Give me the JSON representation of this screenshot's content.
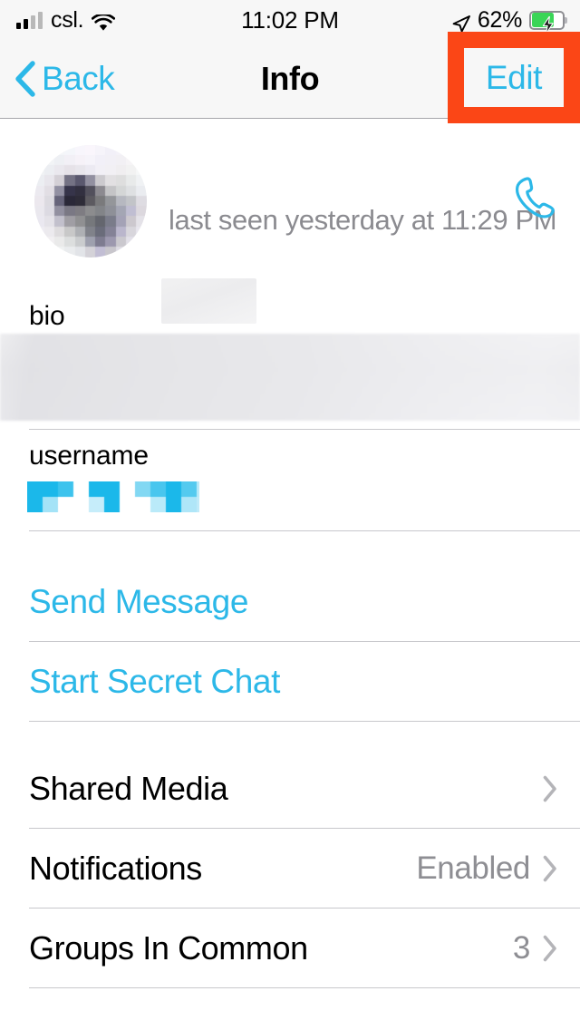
{
  "status_bar": {
    "carrier": "csl.",
    "time": "11:02 PM",
    "battery_percent": "62%",
    "signal_bars_filled": 2,
    "signal_bars_total": 4,
    "wifi_icon": "wifi-icon",
    "location_icon": "location-arrow-icon",
    "battery_icon": "battery-charging-icon",
    "battery_level": 62,
    "charging": true
  },
  "nav_bar": {
    "back_label": "Back",
    "back_icon": "chevron-left-icon",
    "title": "Info",
    "edit_label": "Edit",
    "highlight_color": "#fb4616"
  },
  "profile": {
    "avatar_icon": "avatar-image-pixelated",
    "name": "",
    "name_redacted": true,
    "status": "last seen yesterday at 11:29 PM",
    "call_icon": "phone-call-icon"
  },
  "fields": [
    {
      "label": "bio",
      "value": "",
      "redacted": true,
      "redaction_style": "blur"
    },
    {
      "label": "username",
      "value": "",
      "redacted": true,
      "redaction_style": "pixelate",
      "pixel_color": "#1bb8ea"
    }
  ],
  "actions": [
    {
      "label": "Send Message",
      "name": "send-message"
    },
    {
      "label": "Start Secret Chat",
      "name": "start-secret-chat"
    }
  ],
  "list_rows": [
    {
      "title": "Shared Media",
      "value": "",
      "chevron": "chevron-right-icon",
      "name": "shared-media"
    },
    {
      "title": "Notifications",
      "value": "Enabled",
      "chevron": "chevron-right-icon",
      "name": "notifications"
    },
    {
      "title": "Groups In Common",
      "value": "3",
      "chevron": "chevron-right-icon",
      "name": "groups-in-common"
    }
  ],
  "colors": {
    "accent": "#2cb8e8",
    "text_primary": "#000000",
    "text_secondary": "#8e8e93",
    "separator": "#c8c8cc",
    "navbar_bg": "#f7f7f7",
    "highlight": "#fb4616"
  }
}
